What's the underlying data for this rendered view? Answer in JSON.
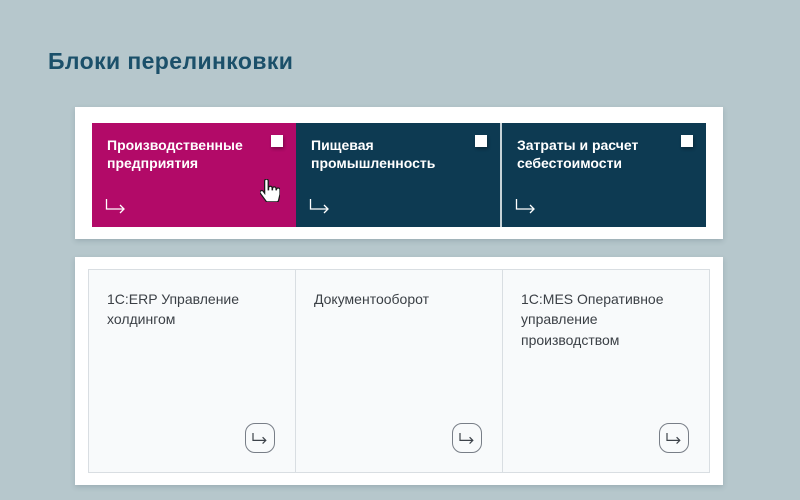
{
  "page": {
    "title": "Блоки перелинковки"
  },
  "colors": {
    "background": "#b6c7cc",
    "title_text": "#1b506a",
    "magenta_card": "#b20a68",
    "teal_card": "#0d3a52",
    "panel": "#ffffff",
    "bottom_card_bg": "#f8fafb",
    "bottom_card_border": "#d9dee2",
    "bottom_text": "#3b4046"
  },
  "top_panel": {
    "cards": [
      {
        "label": "Производственные предприятия"
      },
      {
        "label": "Пищевая промышленность"
      },
      {
        "label": "Затраты и расчет себестоимости"
      }
    ]
  },
  "bottom_panel": {
    "cards": [
      {
        "label": "1С:ERP Управление холдингом"
      },
      {
        "label": "Документооборот"
      },
      {
        "label": "1С:MES Оперативное управление производством"
      }
    ]
  },
  "cursor": {
    "type": "hand-pointer"
  }
}
